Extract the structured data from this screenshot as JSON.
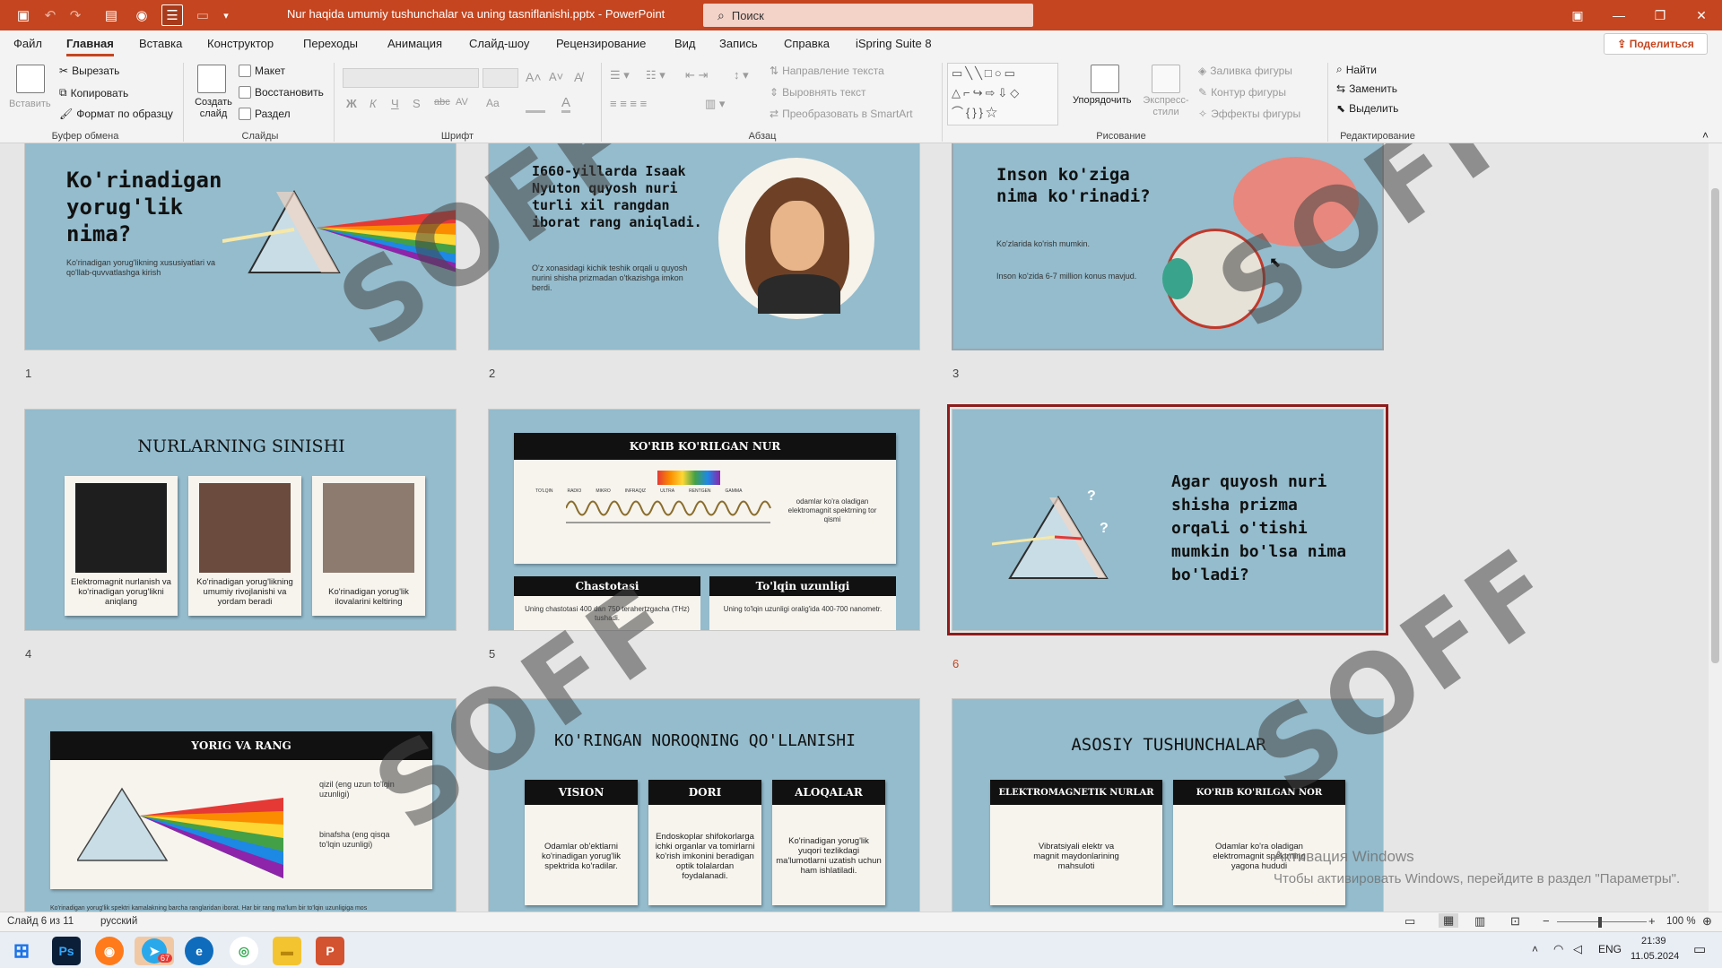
{
  "window": {
    "doc_title": "Nur haqida umumiy tushunchalar va uning tasniflanishi.pptx",
    "app_name": "PowerPoint",
    "title_sep": " - ",
    "search_placeholder": "Поиск"
  },
  "menu": {
    "tabs": [
      "Файл",
      "Главная",
      "Вставка",
      "Конструктор",
      "Переходы",
      "Анимация",
      "Слайд-шоу",
      "Рецензирование",
      "Вид",
      "Запись",
      "Справка",
      "iSpring Suite 8"
    ],
    "active": "Главная",
    "share": "Поделиться"
  },
  "ribbon": {
    "clipboard": {
      "paste": "Вставить",
      "cut": "Вырезать",
      "copy": "Копировать",
      "format": "Формат по образцу",
      "label": "Буфер обмена"
    },
    "slides": {
      "new": "Создать слайд",
      "layout": "Макет",
      "reset": "Восстановить",
      "section": "Раздел",
      "label": "Слайды"
    },
    "font": {
      "label": "Шрифт",
      "bold": "Ж",
      "italic": "К",
      "underline": "Ч",
      "strike": "S",
      "aa": "Aa",
      "fontcolor": "A"
    },
    "paragraph": {
      "text_dir": "Направление текста",
      "align_text": "Выровнять текст",
      "smartart": "Преобразовать в SmartArt",
      "label": "Абзац"
    },
    "drawing": {
      "arrange": "Упорядочить",
      "styles": "Экспресс-стили",
      "fill": "Заливка фигуры",
      "outline": "Контур фигуры",
      "effects": "Эффекты фигуры",
      "label": "Рисование"
    },
    "editing": {
      "find": "Найти",
      "replace": "Заменить",
      "select": "Выделить",
      "label": "Редактирование"
    }
  },
  "slides": [
    {
      "num": "1",
      "title": "Ko'rinadigan yorug'lik nima?",
      "text": "Ko'rinadigan yorug'likning xususiyatlari va qo'llab-quvvatlashga kirish"
    },
    {
      "num": "2",
      "title": "I660-yillarda Isaak Nyuton quyosh nuri turli xil rangdan iborat rang aniqladi.",
      "text": "O'z xonasidagi kichik teshik orqali u quyosh nurini shisha prizmadan o'tkazishga imkon berdi."
    },
    {
      "num": "3",
      "title": "Inson ko'ziga nima ko'rinadi?",
      "text1": "Ko'zlarida ko'rish mumkin.",
      "text2": "Inson ko'zida 6-7 million konus mavjud."
    },
    {
      "num": "4",
      "title": "NURLARNING SINISHI",
      "cards": [
        "Elektromagnit nurlanish va ko'rinadigan yorug'likni aniqlang",
        "Ko'rinadigan yorug'likning umumiy rivojlanishi va yordam beradi",
        "Ko'rinadigan yorug'lik ilovalarini keltiring"
      ]
    },
    {
      "num": "5",
      "title": "KO'RIB KO'RILGAN NUR",
      "spectrum_note": "odamlar ko'ra oladigan elektromagnit spektrning tor qismi",
      "spectrum_labels": [
        "TO'LQIN",
        "RADIO",
        "MIKRO",
        "INFRAQIZ",
        "ULTRA",
        "RENTGEN",
        "GAMMA"
      ],
      "freq_title": "Chastotasi",
      "freq_text": "Uning chastotasi 400 dan 750 terahertzgacha (THz) tushadi.",
      "wave_title": "To'lqin uzunligi",
      "wave_text": "Uning to'lqin uzunligi oralig'ida 400-700 nanometr."
    },
    {
      "num": "6",
      "title": "Agar quyosh nuri shisha prizma orqali o'tishi mumkin bo'lsa nima bo'ladi?",
      "marks": [
        "?",
        "?"
      ]
    },
    {
      "num": "7",
      "title": "YORIG VA RANG",
      "red_label": "qizil (eng uzun to'lqin uzunligi)",
      "violet_label": "binafsha (eng qisqa to'lqin uzunligi)",
      "footer": "Ko'rinadigan yorug'lik spektri kamalakning barcha ranglaridan iborat. Har bir rang ma'lum bir to'lqin uzunligiga mos"
    },
    {
      "num": "8",
      "title": "KO'RINGAN NOROQNING QO'LLANISHI",
      "cols": [
        {
          "head": "VISION",
          "text": "Odamlar ob'ektlarni ko'rinadigan yorug'lik spektrida ko'radilar."
        },
        {
          "head": "DORI",
          "text": "Endoskoplar shifokorlarga ichki organlar va tomirlarni ko'rish imkonini beradigan optik tolalardan foydalanadi."
        },
        {
          "head": "ALOQALAR",
          "text": "Ko'rinadigan yorug'lik yuqori tezlikdagi ma'lumotlarni uzatish uchun ham ishlatiladi."
        }
      ]
    },
    {
      "num": "9",
      "title": "ASOSIY TUSHUNCHALAR",
      "cols": [
        {
          "head": "ELEKTROMAGNETIK NURLAR",
          "text": "Vibratsiyali elektr va magnit maydonlarining mahsuloti"
        },
        {
          "head": "KO'RIB KO'RILGAN NOR",
          "text": "Odamlar ko'ra oladigan elektromagnit spektrning yagona hududi"
        }
      ]
    }
  ],
  "watermark": "SOFF",
  "activation": {
    "line1": "Активация Windows",
    "line2": "Чтобы активировать Windows, перейдите в раздел \"Параметры\"."
  },
  "status": {
    "slide": "Слайд 6 из 11",
    "lang": "русский",
    "zoom": "100 %"
  },
  "taskbar": {
    "lang": "ENG",
    "time": "21:39",
    "date": "11.05.2024",
    "telegram_badge": "67"
  },
  "colors": {
    "accent": "#c4451f",
    "slide_bg": "#94bccd",
    "selected_outline": "#8e1c1c"
  }
}
